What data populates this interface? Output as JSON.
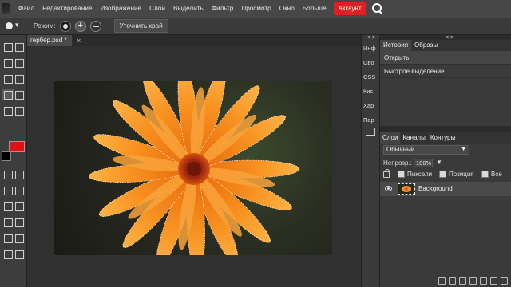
{
  "menubar": {
    "items": [
      "Файл",
      "Редактирование",
      "Изображение",
      "Слой",
      "Выделить",
      "Фильтр",
      "Просмотр",
      "Окно",
      "Больше"
    ],
    "account": "Аккаунт",
    "account_color": "#e02020"
  },
  "options": {
    "mode_label": "Режим:",
    "refine_label": "Уточнить край"
  },
  "document": {
    "tab_title": "гербер.psd *",
    "close": "×"
  },
  "colors": {
    "foreground": "#e01010",
    "background": "#000000"
  },
  "mini_panel": {
    "arrows": "< >",
    "items": [
      "Инф",
      "Сво",
      "CSS",
      "Кис",
      "Хар",
      "Пар"
    ]
  },
  "history_panel": {
    "arrows": "< >",
    "tabs": [
      "История",
      "Образы"
    ],
    "rows": [
      "Открыть",
      "Быстрое выделение"
    ]
  },
  "layers_panel": {
    "tabs": [
      "Слои",
      "Каналы",
      "Контуры"
    ],
    "blend_mode": "Обычный",
    "opacity_label": "Непрозр.:",
    "opacity_value": "100%",
    "lock_options": [
      "Пиксели",
      "Позиция",
      "Все"
    ],
    "layers": [
      {
        "name": "Background",
        "visible": true
      }
    ]
  },
  "icons": [
    "search-icon",
    "brush-icon",
    "eye-icon",
    "lock-icon",
    "image-icon",
    "chevron-down-icon"
  ]
}
